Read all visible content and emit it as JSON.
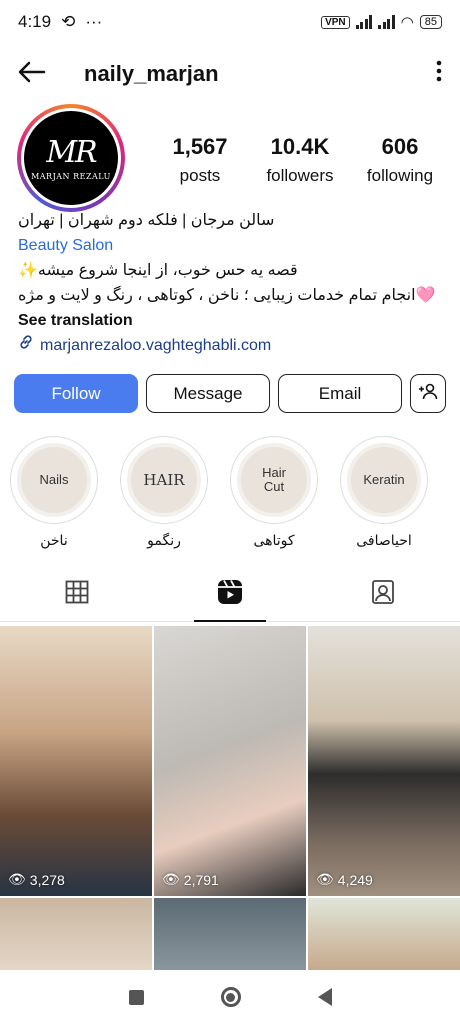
{
  "status_bar": {
    "time": "4:19",
    "vpn": "VPN",
    "battery": "85"
  },
  "header": {
    "username": "naily_marjan"
  },
  "avatar": {
    "monogram": "MR",
    "brand": "MARJAN REZALU"
  },
  "stats": [
    {
      "value": "1,567",
      "label": "posts"
    },
    {
      "value": "10.4K",
      "label": "followers"
    },
    {
      "value": "606",
      "label": "following"
    }
  ],
  "bio": {
    "line1": "سالن مرجان | فلکه دوم شهران | تهران",
    "category": "Beauty Salon",
    "line2": "قصه یه حس خوب، از اینجا شروع میشه✨",
    "line3": "🩷انجام تمام خدمات زیبایی ؛ ناخن ، کوتاهی ، رنگ و لایت و مژه",
    "see_translation": "See translation",
    "link": "marjanrezaloo.vaghteghabli.com"
  },
  "actions": {
    "follow": "Follow",
    "message": "Message",
    "email": "Email"
  },
  "highlights": [
    {
      "cover": "Nails",
      "label": "ناخن"
    },
    {
      "cover": "HAIR",
      "label": "رنگمو"
    },
    {
      "cover": "Hair Cut",
      "label": "کوتاهی"
    },
    {
      "cover": "Keratin",
      "label": "احیاصافی"
    }
  ],
  "posts": [
    {
      "views": "3,278"
    },
    {
      "views": "2,791"
    },
    {
      "views": "4,249"
    }
  ],
  "colors": {
    "follow_button": "#4a7cf0",
    "link": "#2a6bd8"
  }
}
